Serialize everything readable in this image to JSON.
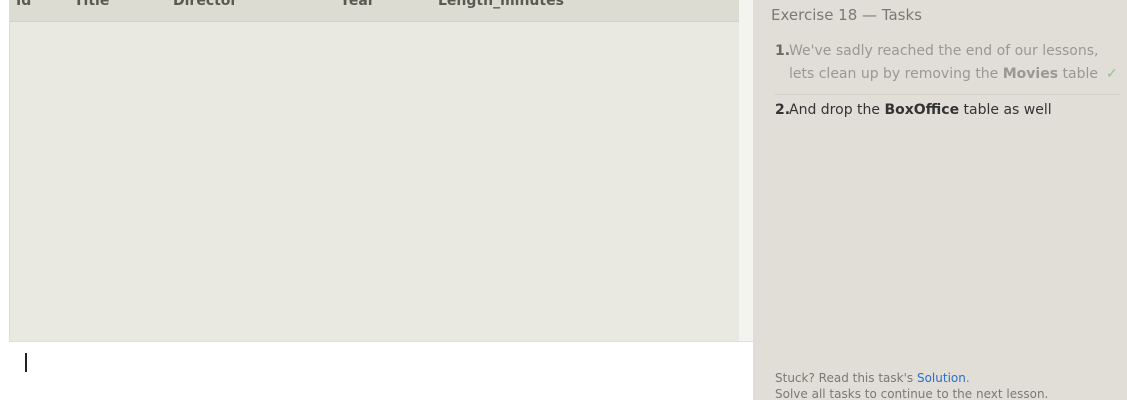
{
  "results": {
    "columns": [
      "Id",
      "Title",
      "Director",
      "Year",
      "Length_minutes"
    ],
    "rows": []
  },
  "editor": {
    "value": ""
  },
  "tasks_panel": {
    "title": "Exercise 18 — Tasks",
    "tasks": [
      {
        "number": "1.",
        "text_before": "We've sadly reached the end of our lessons, lets clean up by removing the ",
        "bold": "Movies",
        "text_after": " table",
        "completed_mark": "✓"
      },
      {
        "number": "2.",
        "text_before": "And drop the ",
        "bold": "BoxOffice",
        "text_after": " table as well"
      }
    ],
    "footer": {
      "stuck_text": "Stuck? Read this task's ",
      "solution_link": "Solution",
      "stuck_end": ".",
      "continue_text": "Solve all tasks to continue to the next lesson."
    }
  },
  "colors": {
    "link": "#2b6fc7",
    "check": "#8ec48e"
  }
}
